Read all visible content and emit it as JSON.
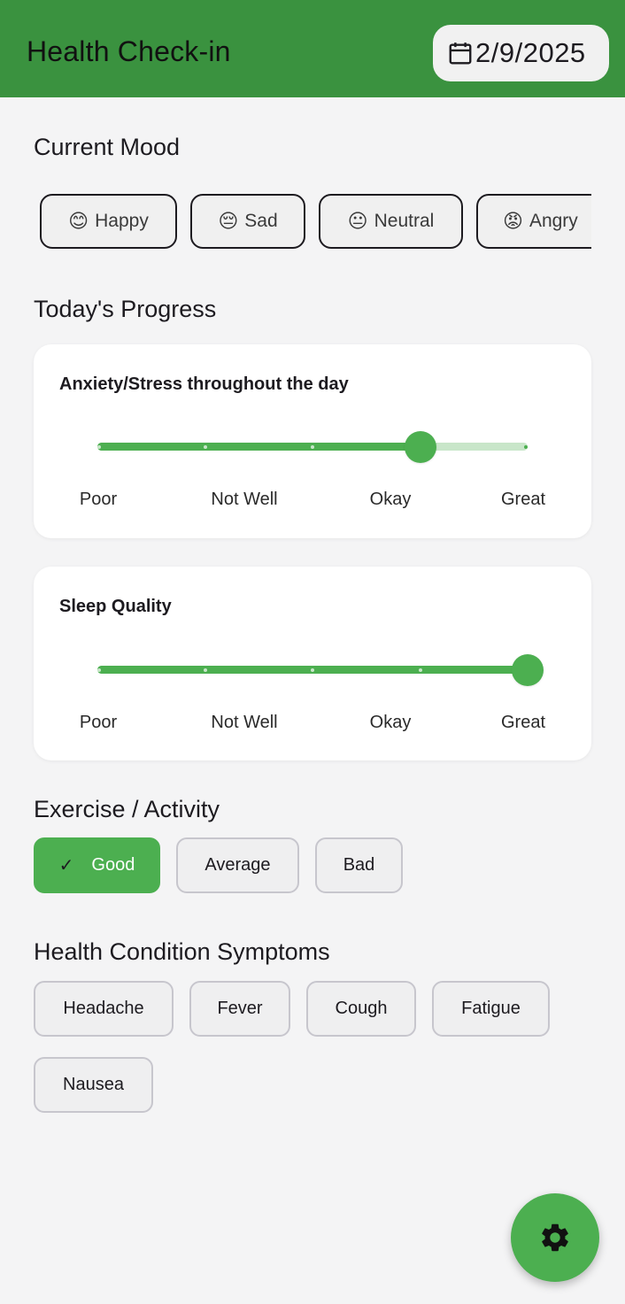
{
  "appbar": {
    "title": "Health Check-in",
    "date": "2/9/2025",
    "color": "#3a923f"
  },
  "mood": {
    "title": "Current Mood",
    "options": [
      {
        "emoji": "😊",
        "label": "Happy"
      },
      {
        "emoji": "😔",
        "label": "Sad"
      },
      {
        "emoji": "😐",
        "label": "Neutral"
      },
      {
        "emoji": "😡",
        "label": "Angry"
      }
    ]
  },
  "progress": {
    "title": "Today's Progress",
    "sliders": [
      {
        "title": "Anxiety/Stress throughout the day",
        "value_fraction": 0.75,
        "labels": [
          "Poor",
          "Not Well",
          "Okay",
          "Great"
        ]
      },
      {
        "title": "Sleep Quality",
        "value_fraction": 1.0,
        "labels": [
          "Poor",
          "Not Well",
          "Okay",
          "Great"
        ]
      }
    ]
  },
  "exercise": {
    "title": "Exercise / Activity",
    "options": [
      "Good",
      "Average",
      "Bad"
    ],
    "selected": "Good",
    "check_icon": "check-icon"
  },
  "symptoms": {
    "title": "Health Condition Symptoms",
    "options": [
      "Headache",
      "Fever",
      "Cough",
      "Fatigue",
      "Nausea"
    ]
  },
  "fab": {
    "icon": "gear-icon"
  },
  "colors": {
    "accent": "#4caf50",
    "track_inactive": "#c8e6c9",
    "background": "#f4f4f5"
  }
}
